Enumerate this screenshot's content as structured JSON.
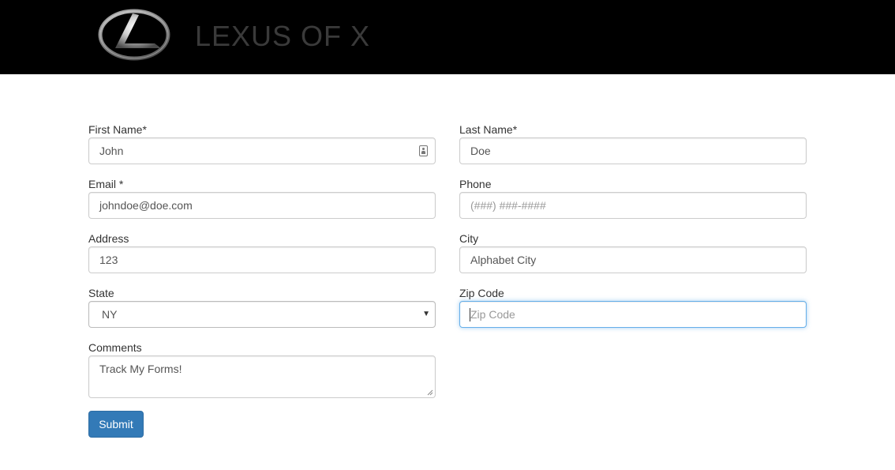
{
  "header": {
    "logo_icon": "lexus-logo-icon",
    "title": "LEXUS OF X",
    "background": "#000000"
  },
  "form": {
    "first_name": {
      "label": "First Name*",
      "value": "John",
      "icon": "contact-card-icon"
    },
    "last_name": {
      "label": "Last Name*",
      "value": "Doe"
    },
    "email": {
      "label": "Email *",
      "value": "johndoe@doe.com"
    },
    "phone": {
      "label": "Phone",
      "placeholder": "(###) ###-####"
    },
    "address": {
      "label": "Address",
      "value": "123"
    },
    "city": {
      "label": "City",
      "value": "Alphabet City"
    },
    "state": {
      "label": "State",
      "selected": "NY"
    },
    "zip": {
      "label": "Zip Code",
      "placeholder": "Zip Code"
    },
    "comments": {
      "label": "Comments",
      "value": "Track My Forms!"
    },
    "submit_label": "Submit"
  },
  "colors": {
    "accent": "#337ab7",
    "focus_border": "#66afe9"
  }
}
